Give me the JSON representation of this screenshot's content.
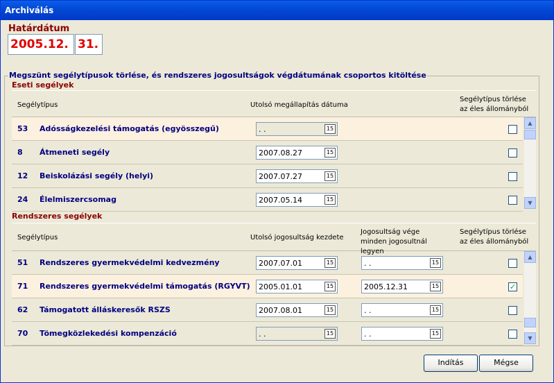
{
  "window": {
    "title": "Archiválás"
  },
  "cutoff": {
    "label": "Határdátum",
    "year_month": "2005.12.",
    "day": "31."
  },
  "group_title": "Megszünt segélytípusok törlése, és rendszeres jogosultságok végdátumának csoportos kitöltése",
  "eseti": {
    "title": "Eseti segélyek",
    "headers": {
      "type": "Segélytípus",
      "last_date": "Utolsó megállapítás dátuma",
      "delete": "Segélytípus törlése az éles állományból"
    },
    "rows": [
      {
        "code": "53",
        "name": "Adósságkezelési támogatás (egyösszegű)",
        "date": " .  .",
        "checked": ""
      },
      {
        "code": "8",
        "name": "Átmeneti segély",
        "date": "2007.08.27",
        "checked": ""
      },
      {
        "code": "12",
        "name": "Beiskolázási segély (helyi)",
        "date": "2007.07.27",
        "checked": ""
      },
      {
        "code": "24",
        "name": "Élelmiszercsomag",
        "date": "2007.05.14",
        "checked": ""
      }
    ]
  },
  "rendszeres": {
    "title": "Rendszeres segélyek",
    "headers": {
      "type": "Segélytípus",
      "last_start": "Utolsó jogosultság kezdete",
      "end_date": "Jogosultság vége minden jogosultnál legyen",
      "delete": "Segélytípus törlése az éles állományból"
    },
    "rows": [
      {
        "code": "51",
        "name": "Rendszeres gyermekvédelmi kedvezmény",
        "start": "2007.07.01",
        "end": " .  .",
        "checked": ""
      },
      {
        "code": "71",
        "name": "Rendszeres gyermekvédelmi támogatás (RGYVT)",
        "start": "2005.01.01",
        "end": "2005.12.31",
        "checked": "✓"
      },
      {
        "code": "62",
        "name": "Támogatott álláskeresők RSZS",
        "start": "2007.08.01",
        "end": " .  .",
        "checked": ""
      },
      {
        "code": "70",
        "name": "Tömegközlekedési kompenzáció",
        "start": " .  .",
        "end": " .  .",
        "checked": ""
      }
    ]
  },
  "calendar_icon_label": "15",
  "buttons": {
    "start": "Indítás",
    "cancel": "Mégse"
  }
}
